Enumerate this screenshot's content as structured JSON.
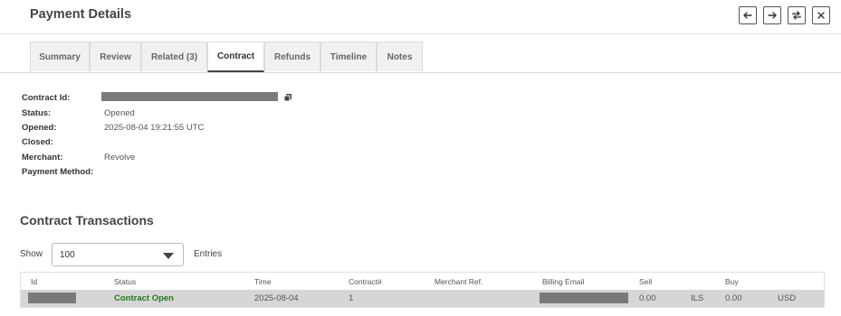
{
  "header": {
    "title": "Payment Details",
    "buttons": [
      "arrow-left-icon",
      "arrow-right-icon",
      "refresh-icon",
      "close-icon"
    ]
  },
  "tabs": [
    {
      "label": "Summary",
      "active": false
    },
    {
      "label": "Review",
      "active": false
    },
    {
      "label": "Related (3)",
      "active": false
    },
    {
      "label": "Contract",
      "active": true
    },
    {
      "label": "Refunds",
      "active": false
    },
    {
      "label": "Timeline",
      "active": false
    },
    {
      "label": "Notes",
      "active": false
    }
  ],
  "contract": {
    "fields": [
      {
        "label": "Contract Id:",
        "value": ""
      },
      {
        "label": "Status:",
        "value": "Opened"
      },
      {
        "label": "Opened:",
        "value": "2025-08-04 19:21:55 UTC"
      },
      {
        "label": "Closed:",
        "value": ""
      },
      {
        "label": "Merchant:",
        "value": "Revolve"
      },
      {
        "label": "Payment Method:",
        "value": ""
      }
    ]
  },
  "transactions": {
    "title": "Contract Transactions",
    "show_label": "Show",
    "entries_label": "Entries",
    "page_size": "100",
    "columns": [
      "Id",
      "Status",
      "Time",
      "Contract#",
      "Merchant Ref.",
      "Billing Email",
      "Sell",
      "Buy"
    ],
    "rows": [
      {
        "id": "",
        "status": "Contract Open",
        "time": "2025-08-04",
        "contract_no": "1",
        "merchant_ref": "",
        "billing_email": "",
        "sell": "0.00",
        "sell_currency": "ILS",
        "buy": "0.00",
        "buy_currency": "USD"
      }
    ]
  },
  "colors": {
    "status_open": "#1f7a1f",
    "row_bg": "#d6d6d6",
    "redaction": "#7a7a7a"
  }
}
